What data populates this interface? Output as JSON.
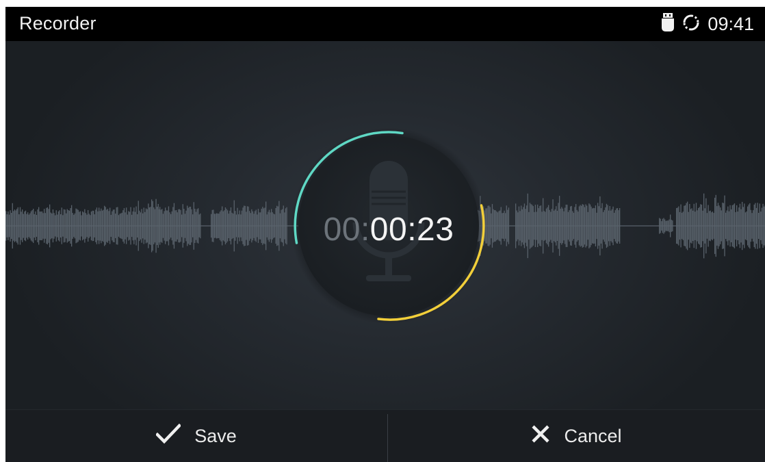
{
  "status_bar": {
    "app_title": "Recorder",
    "time": "09:41",
    "icons": [
      "usb-icon",
      "sync-icon"
    ]
  },
  "recording": {
    "elapsed_dim": "00:",
    "elapsed_main": "00:23",
    "icon": "microphone-icon"
  },
  "actions": {
    "save_label": "Save",
    "save_icon": "check-icon",
    "cancel_label": "Cancel",
    "cancel_icon": "close-icon"
  },
  "colors": {
    "accent_teal": "#5fd8c4",
    "accent_yellow": "#f2cf3a",
    "waveform": "#59626b",
    "background": "#22272c"
  }
}
